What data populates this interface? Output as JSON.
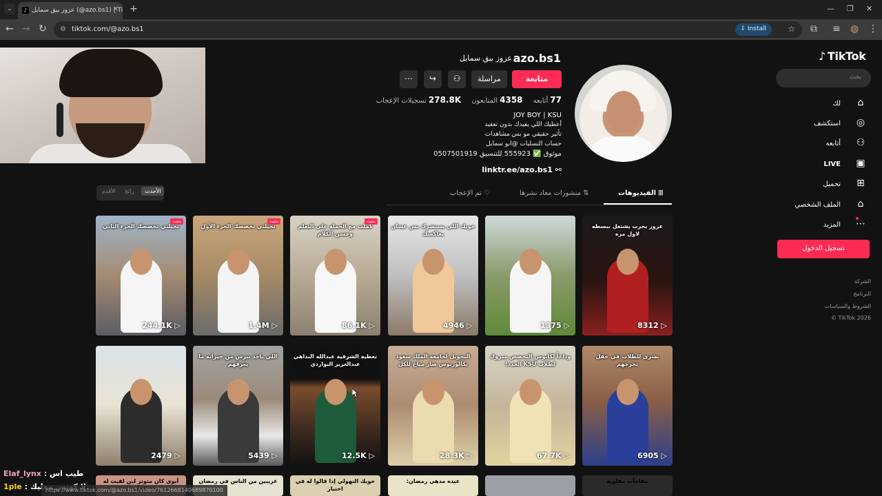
{
  "browser": {
    "tab_title": "عزوز بيق سمايل (@azo.bs1) | Tik",
    "url": "tiktok.com/@azo.bs1",
    "install_label": "Install",
    "status_url": "https://www.tiktok.com/@azo.bs1/video/7612668140689870100"
  },
  "sidebar": {
    "logo": "TikTok",
    "search_placeholder": "بحث",
    "items": [
      {
        "label": "لك",
        "icon": "home-icon"
      },
      {
        "label": "استكشف",
        "icon": "compass-icon"
      },
      {
        "label": "أتابعه",
        "icon": "following-icon"
      },
      {
        "label": "LIVE",
        "icon": "live-icon"
      },
      {
        "label": "تحميل",
        "icon": "upload-icon"
      },
      {
        "label": "الملف الشخصي",
        "icon": "profile-icon"
      },
      {
        "label": "المزيد",
        "icon": "more-icon"
      }
    ],
    "login_label": "تسجيل الدخول",
    "footer": [
      "الشركة",
      "البرنامج",
      "الشروط والسياسات",
      "© TikTok 2026"
    ]
  },
  "profile": {
    "username": "azo.bs1",
    "display_name": "عزوز بيق سمايل",
    "follow_label": "متابعة",
    "message_label": "مراسلة",
    "following_count": "77",
    "following_label": "أتابعه",
    "followers_count": "4358",
    "followers_label": "المتابعون",
    "likes_count": "278.8K",
    "likes_label": "تسجيلات الإعجاب",
    "bio": [
      "JOY BOY | KSU",
      "أعطيك اللي يفيدك بدون تعقيد",
      "تأثير حقيقي مو بس مشاهدات",
      "حساب التسليات @ابو سمايل",
      "موثوق ✅ 555923 للتنسيق 0507501919"
    ],
    "link": "linktr.ee/azo.bs1"
  },
  "profile_tabs": [
    {
      "label": "الفيديوهات",
      "icon": "grid-icon",
      "active": true
    },
    {
      "label": "منشورات معاد نشرها",
      "icon": "repost-icon",
      "active": false
    },
    {
      "label": "تم الإعجاب",
      "icon": "liked-icon",
      "active": false
    }
  ],
  "sort": {
    "options": [
      "الأحدث",
      "رائج",
      "الأقدم"
    ],
    "active": "الأحدث"
  },
  "videos": [
    {
      "caption": "عزوز يجرب يشتغل ببسطه لاول مره",
      "views": "8312",
      "pinned": false
    },
    {
      "caption": "",
      "views": "1375",
      "pinned": false
    },
    {
      "caption": "خويك اللي يستشرك بس عشان يعاكسك",
      "views": "4946",
      "pinned": false
    },
    {
      "caption": "كملت مع الحملة على التعلم وحسن الكلام",
      "views": "86.1K",
      "pinned": true
    },
    {
      "caption": "تخيلني تخصصك الجزء الأول",
      "views": "1.4M",
      "pinned": true
    },
    {
      "caption": "تخيلني تخصصك الجزء الثاني",
      "views": "244.1K",
      "pinned": true
    },
    {
      "caption": "بشرى للطلاب في حفل تخرجهم",
      "views": "6905",
      "pinned": false
    },
    {
      "caption": "وداعاً لكابوس التخصص مبروك لطلاب KSU الجدد!",
      "views": "67.7K",
      "pinned": false
    },
    {
      "caption": "التحويل لجامعة الملك سعود بكالوريوس صار متاح للكل",
      "views": "28.3K",
      "pinned": false
    },
    {
      "caption": "تغطية الشرقية عبدالله النداهي عبدالعزيز البواردي",
      "views": "12.5K",
      "pinned": false
    },
    {
      "caption": "اللي ياخذ بيرس من جيرانه ما يعرفهم",
      "views": "5439",
      "pinned": false
    },
    {
      "caption": "",
      "views": "2479",
      "pinned": false
    },
    {
      "caption": "مفاجآت مقلوبة",
      "views": "",
      "pinned": false
    },
    {
      "caption": "",
      "views": "",
      "pinned": false
    },
    {
      "caption": "عنده مدهي رمضان:",
      "views": "",
      "pinned": false
    },
    {
      "caption": "خويك النهولي إذا قالوا له في اختيار",
      "views": "",
      "pinned": false
    },
    {
      "caption": "غريبين من الناس في رمضان",
      "views": "",
      "pinned": false
    },
    {
      "caption": "أبوي كان متوتر لين لقيت له الحل",
      "views": "",
      "pinned": false
    }
  ],
  "chat": [
    {
      "user": "Elaf_lynx",
      "sep": " : ",
      "text": "طيب اس"
    },
    {
      "user": "1ple",
      "sep": " : ",
      "text": "لا كويس معليك"
    }
  ],
  "colors": {
    "accent": "#fe2c55",
    "background": "#121212"
  }
}
